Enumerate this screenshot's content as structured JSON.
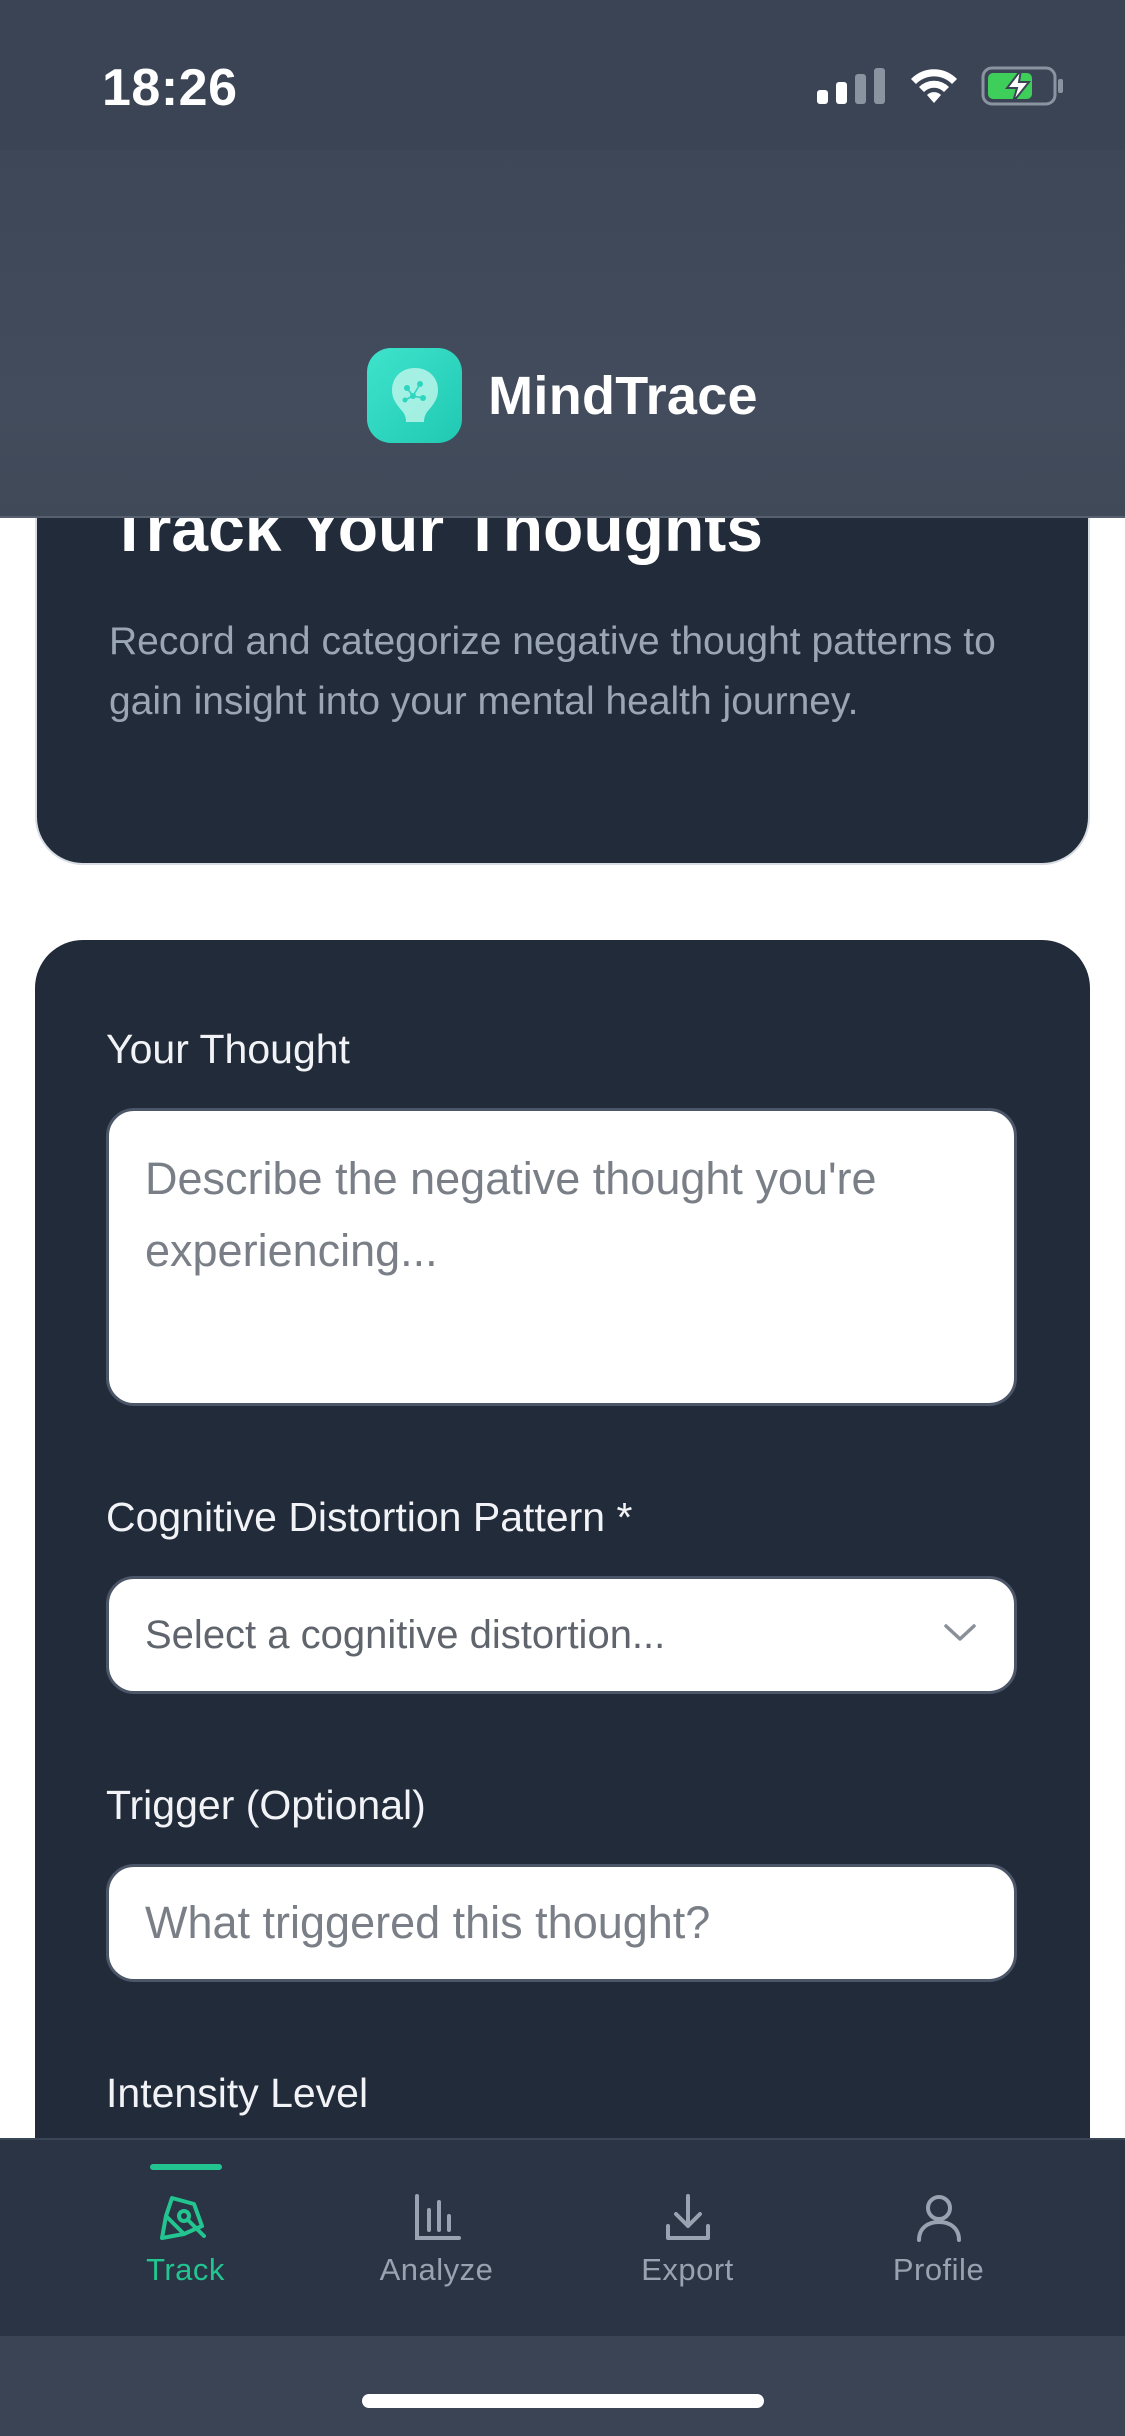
{
  "status_bar": {
    "time": "18:26"
  },
  "header": {
    "app_name": "MindTrace",
    "logo_icon": "brain-bulb-icon"
  },
  "intro": {
    "title": "Track Your Thoughts",
    "description": "Record and categorize negative thought patterns to gain insight into your mental health journey."
  },
  "form": {
    "thought_label": "Your Thought",
    "thought_placeholder": "Describe the negative thought you're experiencing...",
    "distortion_label": "Cognitive Distortion Pattern *",
    "distortion_placeholder": "Select a cognitive distortion...",
    "trigger_label": "Trigger (Optional)",
    "trigger_placeholder": "What triggered this thought?",
    "intensity_label": "Intensity Level"
  },
  "tabs": [
    {
      "label": "Track",
      "icon": "pen-icon",
      "active": true
    },
    {
      "label": "Analyze",
      "icon": "bar-chart-icon",
      "active": false
    },
    {
      "label": "Export",
      "icon": "download-icon",
      "active": false
    },
    {
      "label": "Profile",
      "icon": "user-icon",
      "active": false
    }
  ],
  "colors": {
    "accent": "#22c58f",
    "logo": "#2fd6bf",
    "card": "#222b39",
    "header": "#3d4757"
  }
}
